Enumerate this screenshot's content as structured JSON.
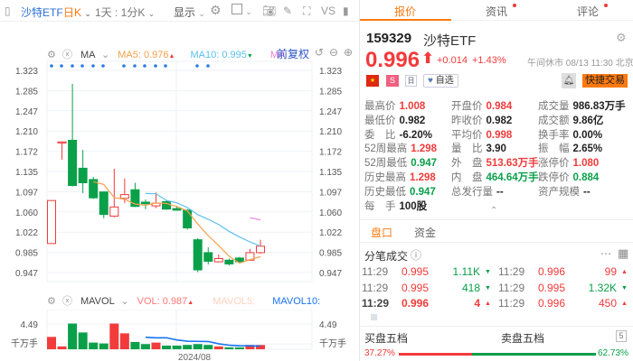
{
  "toolbar": {
    "name": "沙特ETF",
    "period": "日K",
    "intraday": "1天 : 1分K",
    "display": "显示",
    "vs": "VS"
  },
  "indicators": {
    "ma_label": "MA",
    "ma5": "MA5: 0.976",
    "ma10": "MA10: 0.995",
    "ma_more": "MA",
    "adjust": "前复权"
  },
  "volume_header": {
    "label": "MAVOL",
    "vol": "VOL: 0.987",
    "mavol5": "MAVOL5:",
    "mavol10": "MAVOL10:"
  },
  "colors": {
    "up": "#f23b3b",
    "down": "#0aa04a",
    "ma5": "#f7a14a",
    "ma10": "#5bc0f0",
    "ma20": "#e87ee0",
    "mavol10": "#1a73f0",
    "accent": "#ff7a10"
  },
  "chart_data": {
    "type": "candlestick",
    "yticks": [
      "1.323",
      "1.285",
      "1.247",
      "1.210",
      "1.172",
      "1.135",
      "1.097",
      "1.060",
      "1.022",
      "0.985",
      "0.947"
    ],
    "ylim": [
      0.947,
      1.323
    ],
    "xlabel_date": "2024/08",
    "candles": [
      {
        "o": 1.001,
        "c": 1.081,
        "h": 1.081,
        "l": 1.001
      },
      {
        "o": 1.188,
        "c": 1.19,
        "h": 1.19,
        "l": 1.157
      },
      {
        "o": 1.193,
        "c": 1.109,
        "h": 1.298,
        "l": 1.107
      },
      {
        "o": 1.141,
        "c": 1.114,
        "h": 1.175,
        "l": 1.095
      },
      {
        "o": 1.12,
        "c": 1.086,
        "h": 1.125,
        "l": 1.084
      },
      {
        "o": 1.097,
        "c": 1.055,
        "h": 1.097,
        "l": 1.048
      },
      {
        "o": 1.052,
        "c": 1.069,
        "h": 1.14,
        "l": 1.05
      },
      {
        "o": 1.085,
        "c": 1.092,
        "h": 1.122,
        "l": 1.076
      },
      {
        "o": 1.101,
        "c": 1.07,
        "h": 1.114,
        "l": 1.069
      },
      {
        "o": 1.078,
        "c": 1.075,
        "h": 1.083,
        "l": 1.065
      },
      {
        "o": 1.071,
        "c": 1.076,
        "h": 1.096,
        "l": 1.067
      },
      {
        "o": 1.079,
        "c": 1.065,
        "h": 1.082,
        "l": 1.064
      },
      {
        "o": 1.066,
        "c": 1.063,
        "h": 1.071,
        "l": 1.062
      },
      {
        "o": 1.063,
        "c": 1.03,
        "h": 1.065,
        "l": 1.027
      },
      {
        "o": 1.008,
        "c": 0.952,
        "h": 1.011,
        "l": 0.948
      },
      {
        "o": 0.984,
        "c": 0.968,
        "h": 0.994,
        "l": 0.962
      },
      {
        "o": 0.967,
        "c": 0.973,
        "h": 0.981,
        "l": 0.966
      },
      {
        "o": 0.97,
        "c": 0.963,
        "h": 0.973,
        "l": 0.96
      },
      {
        "o": 0.974,
        "c": 0.967,
        "h": 0.976,
        "l": 0.967
      },
      {
        "o": 0.97,
        "c": 0.984,
        "h": 0.991,
        "l": 0.969
      },
      {
        "o": 0.984,
        "c": 0.996,
        "h": 1.008,
        "l": 0.982
      }
    ],
    "volume": [
      3.04,
      0.61,
      6.45,
      4.17,
      1.59,
      1.37,
      6.45,
      3.95,
      1.75,
      1.21,
      1.59,
      0.83,
      0.83,
      0.99,
      1.21,
      0.99,
      0.61,
      0.38,
      0.38,
      0.99,
      0.987
    ],
    "volume_tick": "4.49",
    "volume_unit": "千万手"
  },
  "quote": {
    "tabs": [
      {
        "label": "报价"
      },
      {
        "label": "资讯"
      },
      {
        "label": "评论"
      }
    ],
    "code": "159329",
    "name": "沙特ETF",
    "price": "0.996",
    "change": "+0.014",
    "pct": "+1.43%",
    "status": "午间休市 08/13 11:30 北京",
    "watch": "自选",
    "trade": "快捷交易",
    "stats": [
      [
        {
          "k": "最高价",
          "v": "1.008",
          "c": "red"
        },
        {
          "k": "开盘价",
          "v": "0.984",
          "c": "red"
        },
        {
          "k": "成交量",
          "v": "986.83万手",
          "c": "dark"
        }
      ],
      [
        {
          "k": "最低价",
          "v": "0.982",
          "c": "dark"
        },
        {
          "k": "昨收价",
          "v": "0.982",
          "c": "dark"
        },
        {
          "k": "成交额",
          "v": "9.86亿",
          "c": "dark"
        }
      ],
      [
        {
          "k": "委　比",
          "v": "-6.20%",
          "c": "dark"
        },
        {
          "k": "平均价",
          "v": "0.998",
          "c": "red"
        },
        {
          "k": "换手率",
          "v": "0.00%",
          "c": "dark"
        }
      ],
      [
        {
          "k": "52周最高",
          "v": "1.298",
          "c": "red"
        },
        {
          "k": "量　比",
          "v": "3.90",
          "c": "dark"
        },
        {
          "k": "振　幅",
          "v": "2.65%",
          "c": "dark"
        }
      ],
      [
        {
          "k": "52周最低",
          "v": "0.947",
          "c": "green"
        },
        {
          "k": "外　盘",
          "v": "513.63万手",
          "c": "red"
        },
        {
          "k": "涨停价",
          "v": "1.080",
          "c": "red"
        }
      ],
      [
        {
          "k": "历史最高",
          "v": "1.298",
          "c": "red"
        },
        {
          "k": "内　盘",
          "v": "464.64万手",
          "c": "green"
        },
        {
          "k": "跌停价",
          "v": "0.884",
          "c": "green"
        }
      ],
      [
        {
          "k": "历史最低",
          "v": "0.947",
          "c": "green"
        },
        {
          "k": "总发行量",
          "v": "--",
          "c": "dark"
        },
        {
          "k": "资产规模",
          "v": "--",
          "c": "dark"
        }
      ],
      [
        {
          "k": "每　手",
          "v": "100股",
          "c": "dark"
        }
      ]
    ],
    "subtabs": [
      {
        "label": "盘口"
      },
      {
        "label": "资金"
      }
    ],
    "ticks_title": "分笔成交",
    "ticks": [
      [
        {
          "t": "11:29",
          "p": "0.995",
          "v": "1.11K",
          "d": "down"
        },
        {
          "t": "11:29",
          "p": "0.996",
          "v": "99",
          "d": "up"
        }
      ],
      [
        {
          "t": "11:29",
          "p": "0.995",
          "v": "418",
          "d": "down"
        },
        {
          "t": "11:29",
          "p": "0.995",
          "v": "1.32K",
          "d": "down"
        }
      ],
      [
        {
          "t": "11:29",
          "p": "0.996",
          "v": "4",
          "d": "up",
          "bold": true
        },
        {
          "t": "11:29",
          "p": "0.996",
          "v": "450",
          "d": "up"
        }
      ]
    ],
    "buy_title": "买盘五档",
    "sell_title": "卖盘五档",
    "depth_level": "5",
    "buy_pct": "37.27%",
    "sell_pct": "62.73%",
    "buy_ratio": 37.27
  }
}
